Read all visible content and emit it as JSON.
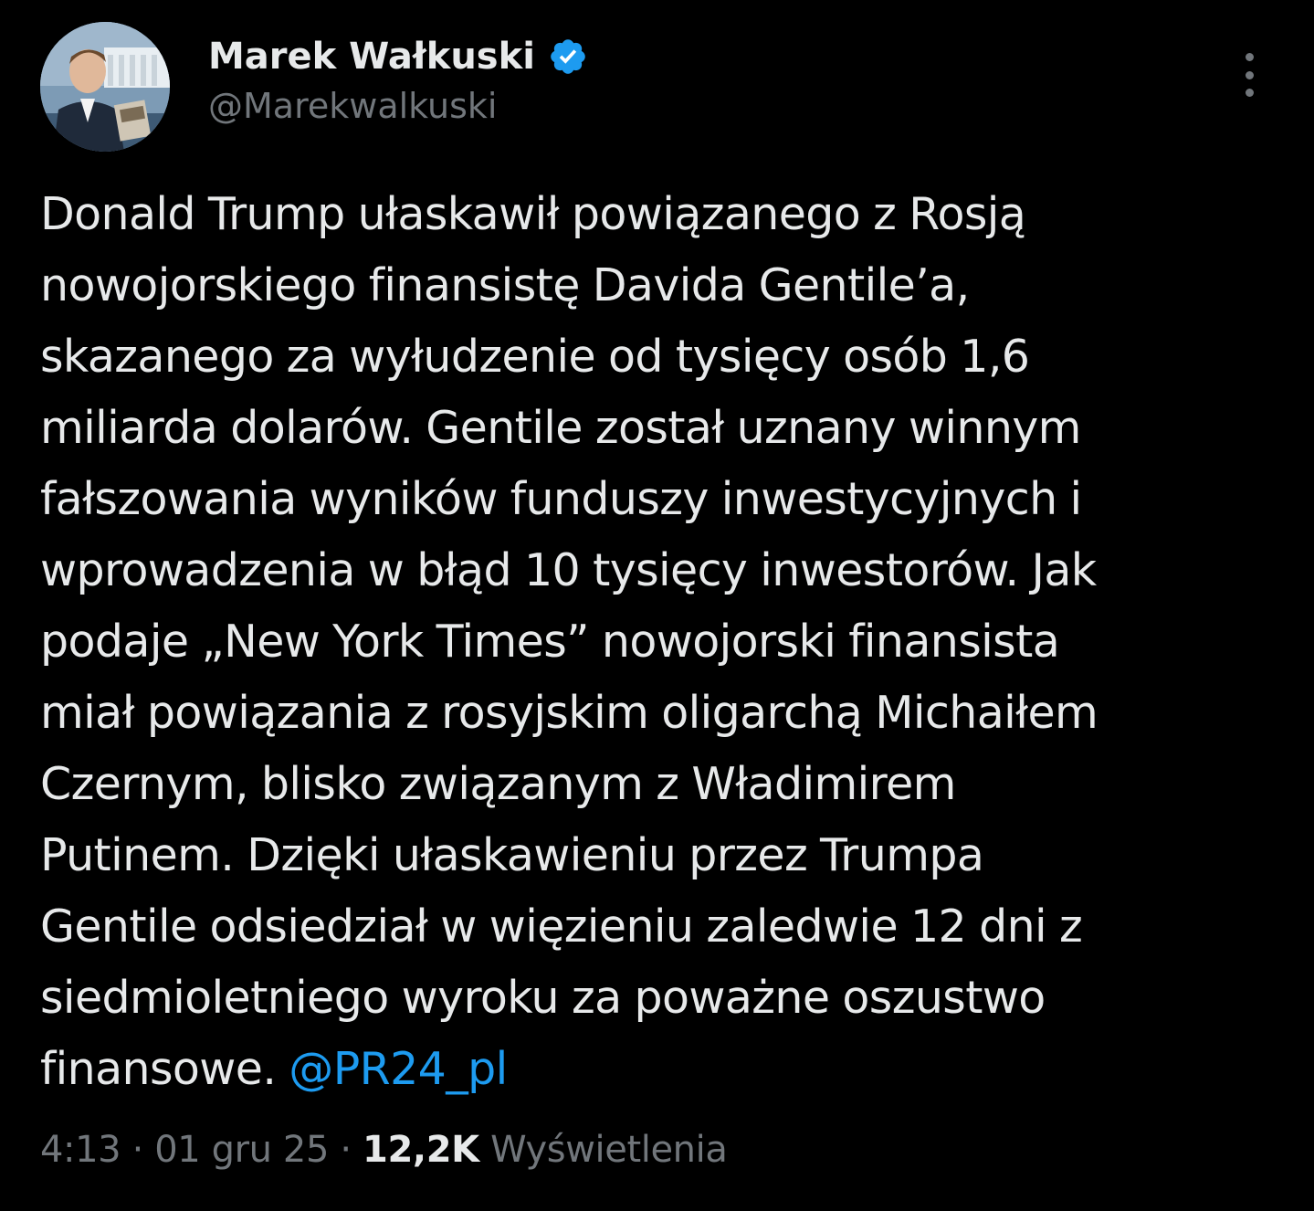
{
  "author": {
    "name": "Marek Wałkuski",
    "handle": "@Marekwalkuski",
    "verified_icon": "verified-badge-icon",
    "verified_color": "#1d9bf0"
  },
  "tweet": {
    "lines": [
      "Donald Trump ułaskawił powiązanego z Rosją",
      "nowojorskiego finansistę Davida Gentile’a,",
      "skazanego za wyłudzenie od tysięcy osób 1,6",
      "miliarda dolarów. Gentile został uznany winnym",
      "fałszowania wyników funduszy inwestycyjnych i",
      "wprowadzenia w błąd 10 tysięcy inwestorów. Jak",
      "podaje „New York Times” nowojorski finansista",
      "miał powiązania z rosyjskim oligarchą Michaiłem",
      "Czernym, blisko związanym z Władimirem",
      "Putinem. Dzięki ułaskawieniu przez Trumpa",
      "Gentile odsiedział w więzieniu zaledwie 12 dni z",
      "siedmioletniego wyroku za poważne oszustwo"
    ],
    "last_line_text": "finansowe.",
    "mention": "@PR24_pl"
  },
  "meta": {
    "time": "4:13",
    "separator": "·",
    "date": "01 gru 25",
    "views_count": "12,2K",
    "views_label": "Wyświetlenia"
  },
  "colors": {
    "background": "#000000",
    "text": "#e7e9ea",
    "secondary": "#71767b",
    "accent": "#1d9bf0"
  }
}
